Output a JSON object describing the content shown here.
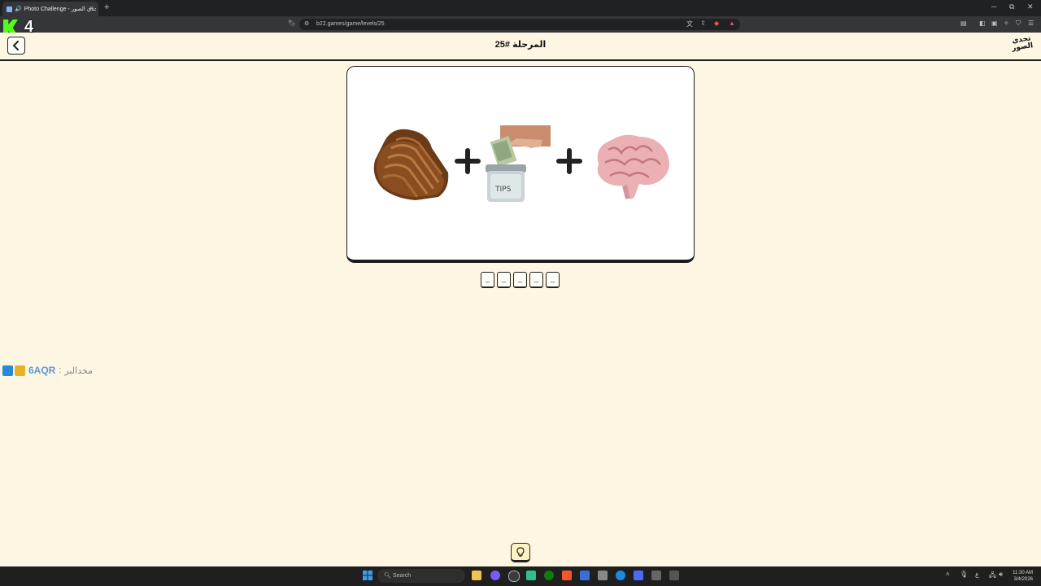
{
  "browser": {
    "tab_title": "Photo Challenge - تحدي الصور",
    "tab_close": "✕",
    "new_tab": "+",
    "url": "b22.games/game/levels/25",
    "win_minimize": "─",
    "win_restore": "⧉",
    "win_close": "✕"
  },
  "overlay": {
    "kick_number": "4"
  },
  "game": {
    "level_title": "المرحلة #25",
    "logo_text": "تحدي الصور",
    "puzzle_items": [
      "bread",
      "tips-jar",
      "brain"
    ],
    "plus_symbol": "+",
    "answer_slots": [
      "_",
      "_",
      "_",
      "_",
      "_"
    ]
  },
  "chat": {
    "username": "6AQR",
    "separator": ":",
    "message": "مخدالبر"
  },
  "taskbar": {
    "search_label": "Search",
    "time": "11:30 AM",
    "date": "3/4/2026",
    "lang": "ع"
  }
}
